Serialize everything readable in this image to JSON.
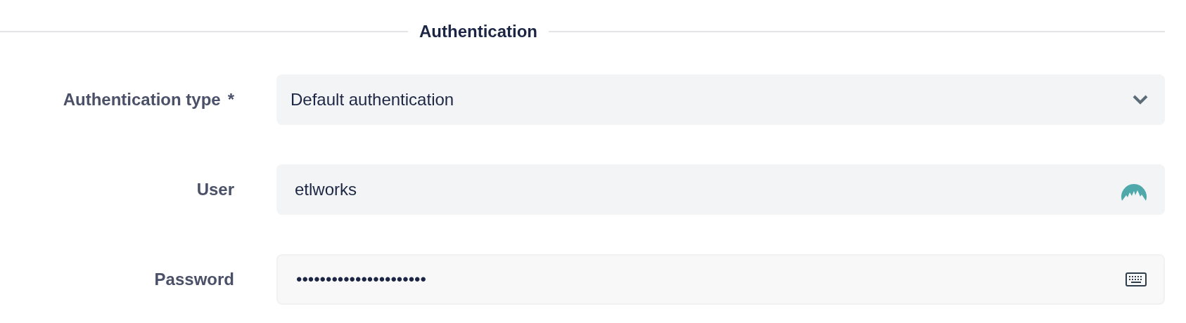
{
  "section": {
    "title": "Authentication"
  },
  "fields": [
    {
      "kind": "select",
      "label": "Authentication type",
      "required_mark": "*",
      "value": "Default authentication"
    },
    {
      "kind": "text",
      "label": "User",
      "value": "etlworks"
    },
    {
      "kind": "password",
      "label": "Password",
      "value": "••••••••••••••••••••••"
    }
  ]
}
